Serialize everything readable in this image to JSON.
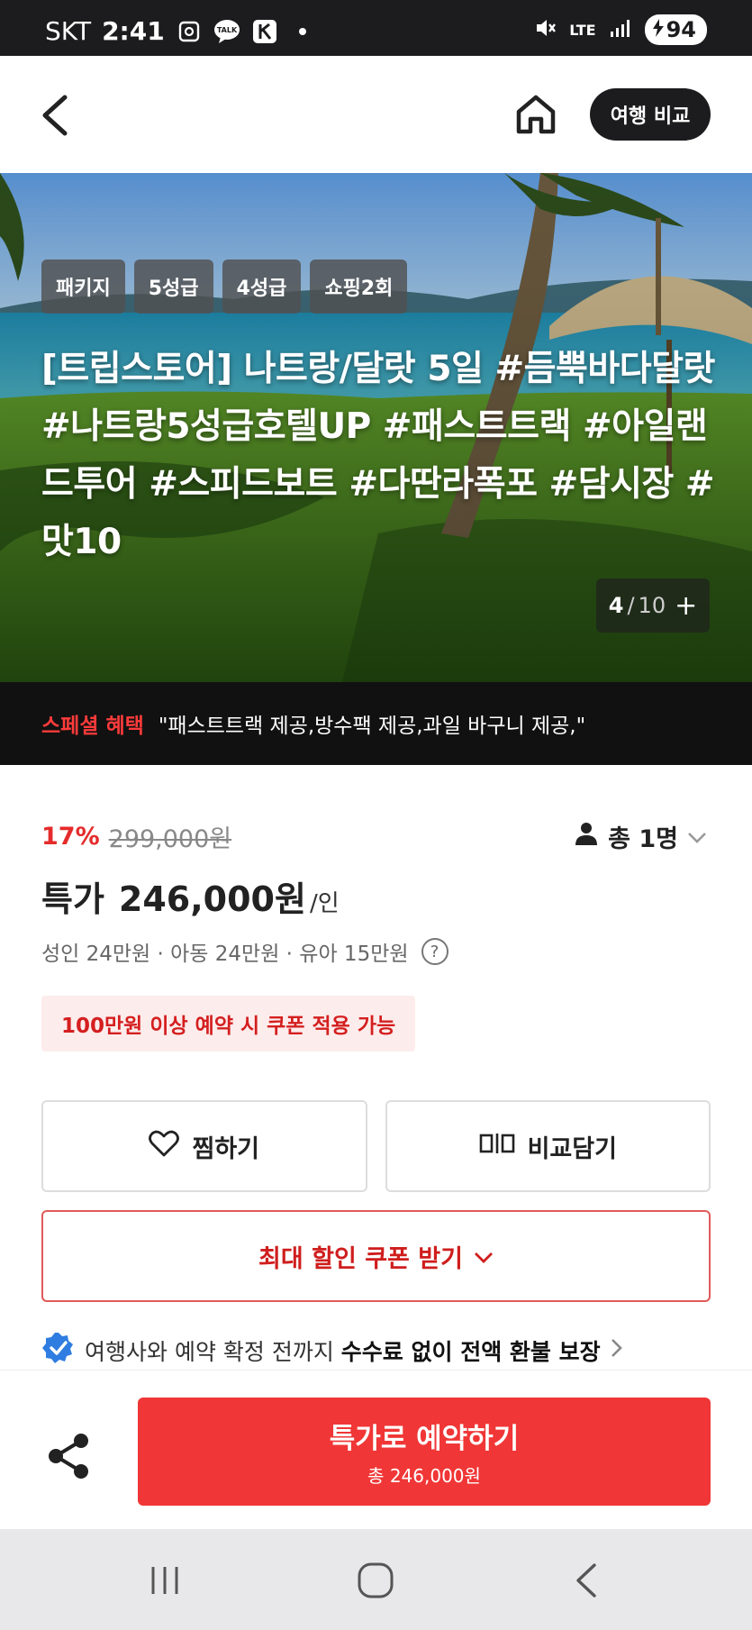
{
  "status_bar": {
    "carrier": "SKT",
    "time": "2:41",
    "network": "LTE",
    "battery": "94"
  },
  "nav": {
    "compare_label": "여행 비교"
  },
  "hero": {
    "tags": [
      "패키지",
      "5성급",
      "4성급",
      "쇼핑2회"
    ],
    "title": "[트립스토어] 나트랑/달랏 5일 #듬뿍바다달랏 #나트랑5성급호텔UP #패스트트랙 #아일랜드투어 #스피드보트 #다딴라폭포 #담시장 #맛10",
    "counter": {
      "current": "4",
      "separator": "/",
      "total": "10",
      "more": "+"
    }
  },
  "special": {
    "label": "스페셜 혜택",
    "text": "\"패스트트랙 제공,방수팩 제공,과일 바구니 제공,\""
  },
  "price": {
    "discount_pct": "17%",
    "original": "299,000원",
    "people": "총 1명",
    "label": "특가",
    "value": "246,000원",
    "unit": "/인",
    "age_breakdown": "성인 24만원 · 아동 24만원 · 유아 15만원",
    "coupon_note": "100만원 이상 예약 시 쿠폰 적용 가능"
  },
  "actions": {
    "wishlist": "찜하기",
    "compare_add": "비교담기",
    "coupon": "최대 할인 쿠폰 받기",
    "refund_prefix": "여행사와 예약 확정 전까지 ",
    "refund_bold": "수수료 없이 전액 환불 보장"
  },
  "booking": {
    "main": "특가로 예약하기",
    "sub": "총 246,000원"
  },
  "colors": {
    "accent_red": "#f03636",
    "discount_red": "#e52b2b",
    "dark": "#1c1c1e",
    "verified_blue": "#2f7de1"
  }
}
